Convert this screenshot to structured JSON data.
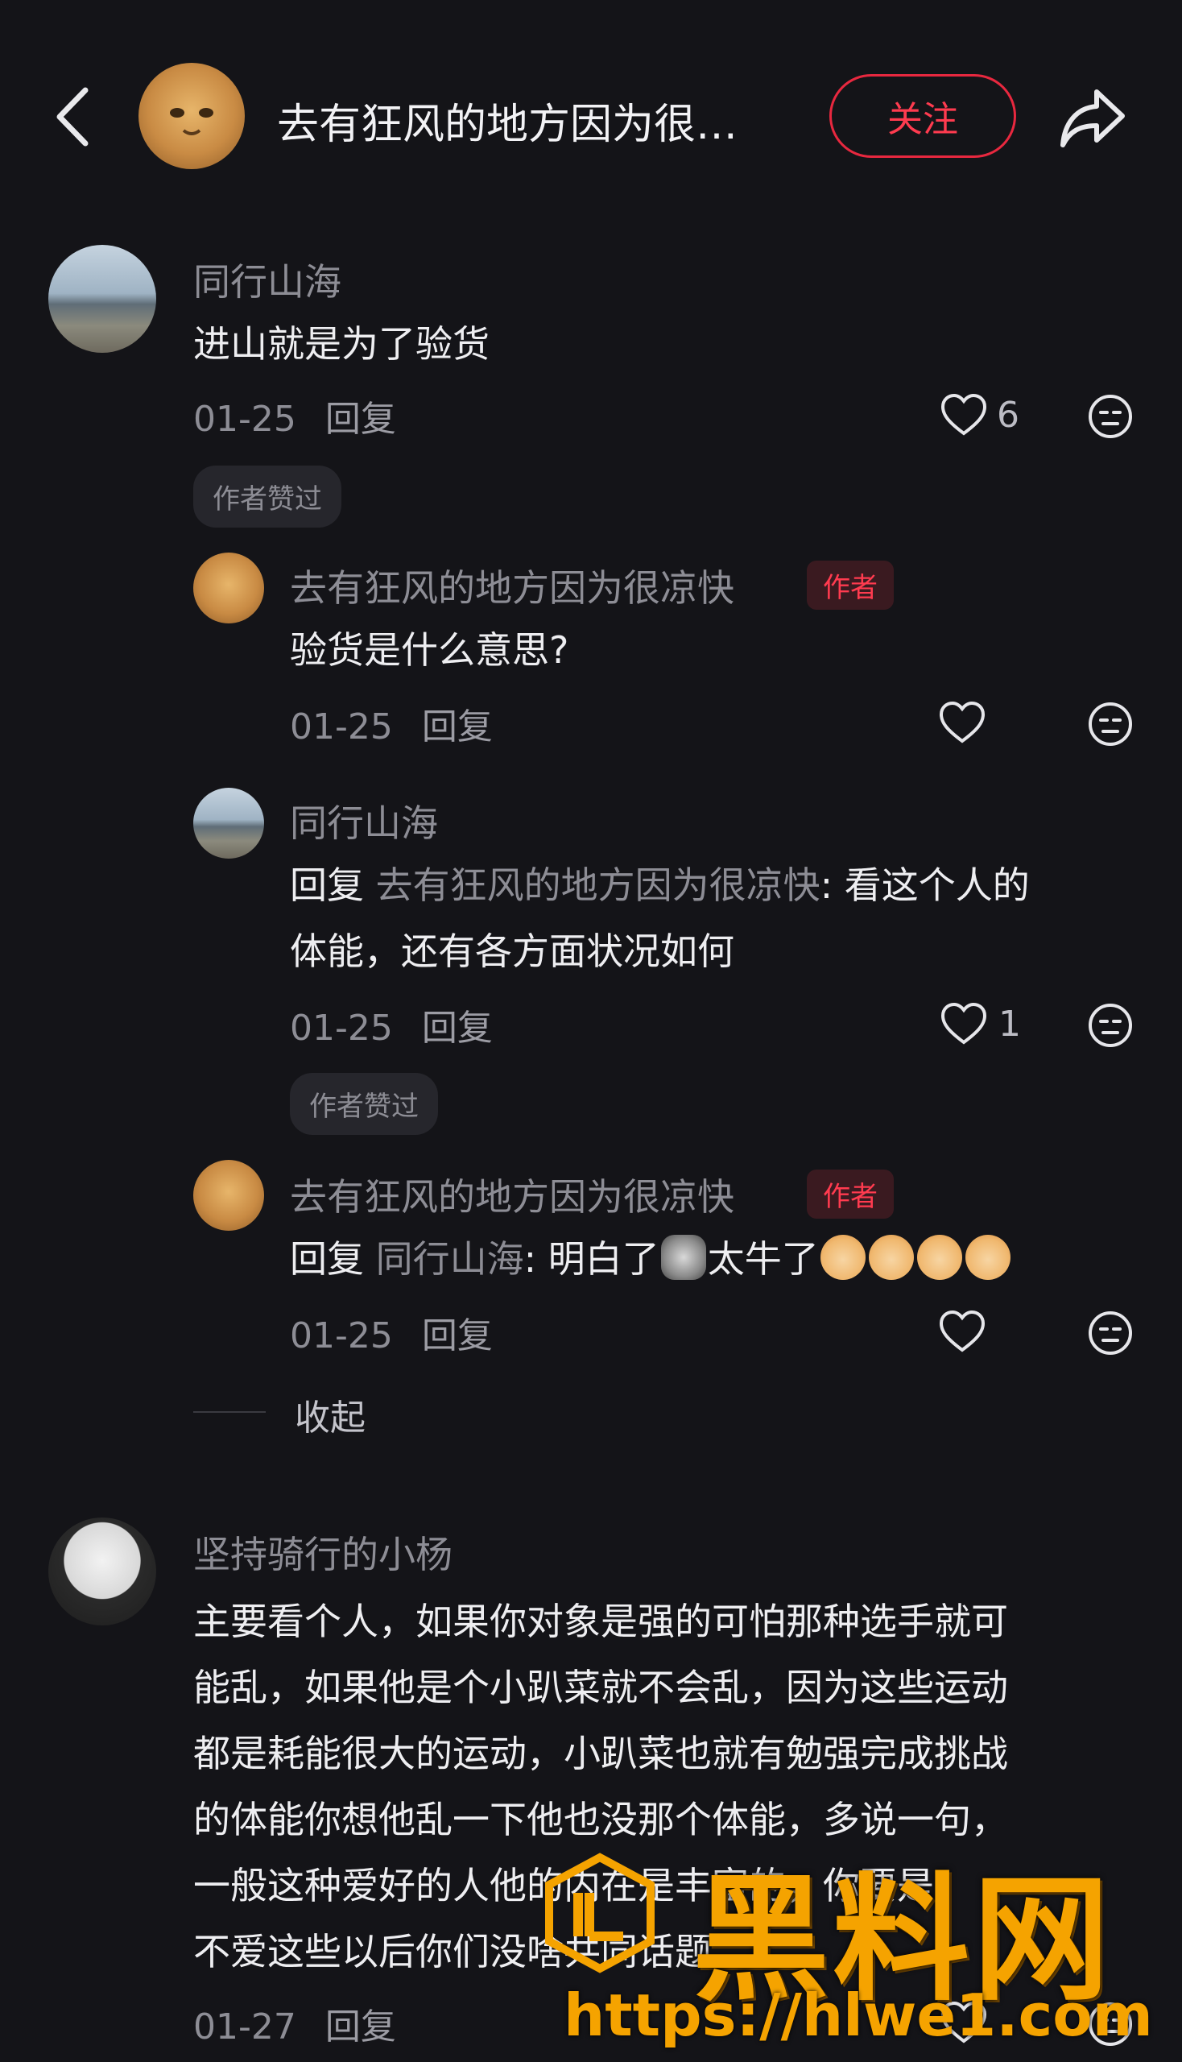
{
  "header": {
    "title": "去有狂风的地方因为很凉快",
    "follow_label": "关注",
    "back_icon": "chevron-left-icon",
    "share_icon": "share-arrow-icon"
  },
  "comments": [
    {
      "name": "同行山海",
      "text": "进山就是为了验货",
      "date": "01-25",
      "reply_label": "回复",
      "likes": "6",
      "liked_badge": "作者赞过"
    },
    {
      "name": "去有狂风的地方因为很凉快",
      "author_badge": "作者",
      "text": "验货是什么意思?",
      "date": "01-25",
      "reply_label": "回复"
    },
    {
      "name": "同行山海",
      "reply_prefix": "回复",
      "reply_to": "去有狂风的地方因为很凉快",
      "text_line1": ": 看这个人的",
      "text_line2": "体能，还有各方面状况如何",
      "date": "01-25",
      "reply_label": "回复",
      "likes": "1",
      "liked_badge": "作者赞过"
    },
    {
      "name": "去有狂风的地方因为很凉快",
      "author_badge": "作者",
      "reply_prefix": "回复",
      "reply_to": "同行山海",
      "text_a": ": 明白了",
      "text_b": "太牛了",
      "date": "01-25",
      "reply_label": "回复"
    },
    {
      "name": "坚持骑行的小杨",
      "lines": [
        "主要看个人，如果你对象是强的可怕那种选手就可",
        "能乱，如果他是个小趴菜就不会乱，因为这些运动",
        "都是耗能很大的运动，小趴菜也就有勉强完成挑战",
        "的体能你想他乱一下他也没那个体能，多说一句，",
        "一般这种爱好的人他的内在是丰富的，你要是",
        "不爱这些以后你们没啥共同话题"
      ],
      "date": "01-27",
      "reply_label": "回复"
    }
  ],
  "collapse_label": "收起",
  "watermark": {
    "logo_text": "黑料网",
    "url": "https://hlwe1.com"
  },
  "colors": {
    "background": "#141418",
    "accent_red": "#ff3b4f",
    "watermark": "#f5a300"
  }
}
